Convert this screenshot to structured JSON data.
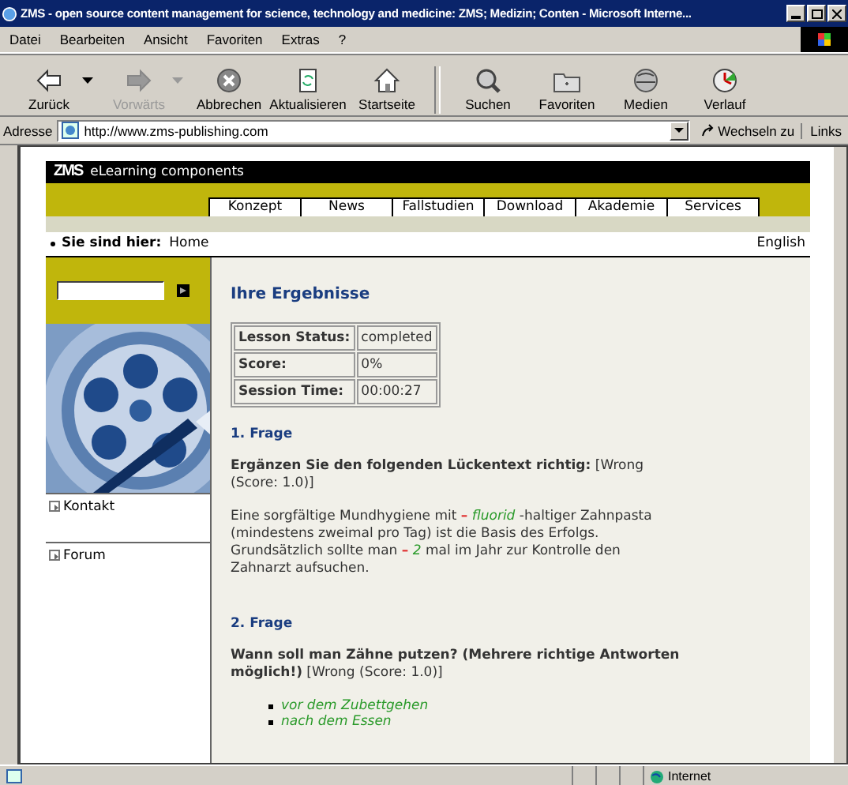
{
  "window": {
    "title": "ZMS - open source content management for science, technology and medicine: ZMS; Medizin; Conten - Microsoft Interne..."
  },
  "menu": [
    "Datei",
    "Bearbeiten",
    "Ansicht",
    "Favoriten",
    "Extras",
    "?"
  ],
  "toolbar": [
    {
      "label": "Zurück",
      "disabled": false,
      "has_menu": true
    },
    {
      "label": "Vorwärts",
      "disabled": true,
      "has_menu": true
    },
    {
      "label": "Abbrechen",
      "disabled": false,
      "has_menu": false
    },
    {
      "label": "Aktualisieren",
      "disabled": false,
      "has_menu": false
    },
    {
      "label": "Startseite",
      "disabled": false,
      "has_menu": false
    },
    {
      "label": "Suchen",
      "disabled": false,
      "has_menu": false
    },
    {
      "label": "Favoriten",
      "disabled": false,
      "has_menu": false
    },
    {
      "label": "Medien",
      "disabled": false,
      "has_menu": false
    },
    {
      "label": "Verlauf",
      "disabled": false,
      "has_menu": false
    }
  ],
  "address_bar": {
    "label": "Adresse",
    "value": "http://www.zms-publishing.com",
    "go": "Wechseln zu",
    "links": "Links"
  },
  "page": {
    "logo": "ZMS",
    "subtitle": "eLearning components",
    "nav": [
      {
        "label": "Konzept",
        "selected": false
      },
      {
        "label": "News",
        "selected": false
      },
      {
        "label": "Fallstudien",
        "selected": false
      },
      {
        "label": "Download",
        "selected": false
      },
      {
        "label": "Akademie",
        "selected": false
      },
      {
        "label": "Services",
        "selected": false
      }
    ],
    "breadcrumb": {
      "label": "Sie sind hier:",
      "current": "Home"
    },
    "language": "English",
    "sidebar": {
      "links": [
        "Kontakt",
        "Forum"
      ]
    },
    "results": {
      "title": "Ihre Ergebnisse",
      "rows": [
        {
          "label": "Lesson Status:",
          "value": "completed"
        },
        {
          "label": "Score:",
          "value": "0%"
        },
        {
          "label": "Session Time:",
          "value": "00:00:27"
        }
      ]
    },
    "questions": [
      {
        "title": "1. Frage",
        "prompt": "**Ergänzen Sie den folgenden Lückentext richtig:** [Wrong (Score: 1.0)]",
        "kind": "cloze",
        "parts": [
          {
            "kind": "text",
            "text": "Eine sorgfältige Mundhygiene mit "
          },
          {
            "kind": "wrong",
            "text": "–"
          },
          {
            "kind": "answer",
            "text": " fluorid"
          },
          {
            "kind": "text",
            "text": " -haltiger Zahnpasta (mindestens zweimal pro Tag) ist die Basis des Erfolgs. Grundsätzlich sollte man "
          },
          {
            "kind": "wrong",
            "text": "–"
          },
          {
            "kind": "answer",
            "text": " 2"
          },
          {
            "kind": "text",
            "text": " mal im Jahr zur Kontrolle den Zahnarzt aufsuchen."
          }
        ]
      },
      {
        "title": "2. Frage",
        "prompt": "**Wann soll man Zähne putzen? (Mehrere richtige Antworten möglich!)** [Wrong (Score: 1.0)]",
        "kind": "choice",
        "answers": [
          "vor dem Zubettgehen",
          "nach dem Essen"
        ]
      }
    ]
  },
  "status_bar": {
    "zone": "Internet"
  }
}
